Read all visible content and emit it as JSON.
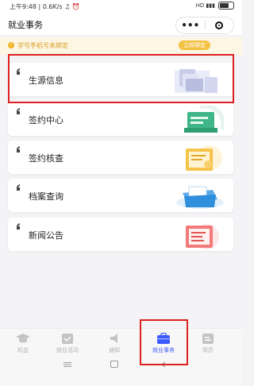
{
  "status_bar": {
    "left_text": "上午9:48 | 0.6K/s ♫ ⏰",
    "right_text": "HD ▮▮▮"
  },
  "navbar": {
    "title": "就业事务",
    "more_label": "•••"
  },
  "notice": {
    "text": "学号手机号未绑定",
    "button": "立即绑定",
    "icon": "!"
  },
  "cards": [
    {
      "label": "生源信息",
      "icon": "student-source-illustration"
    },
    {
      "label": "签约中心",
      "icon": "contract-center-illustration"
    },
    {
      "label": "签约核查",
      "icon": "contract-check-illustration"
    },
    {
      "label": "档案查询",
      "icon": "archive-query-illustration"
    },
    {
      "label": "新闻公告",
      "icon": "news-announcement-illustration"
    }
  ],
  "tabbar": {
    "active_color": "#3d5afe",
    "items": [
      {
        "label": "机会",
        "icon": "graduation-cap-icon"
      },
      {
        "label": "就业活动",
        "icon": "calendar-icon"
      },
      {
        "label": "通知",
        "icon": "speaker-icon"
      },
      {
        "label": "就业事务",
        "icon": "briefcase-icon",
        "active": true
      },
      {
        "label": "简历",
        "icon": "resume-icon"
      }
    ]
  },
  "highlight_color": "#e02020"
}
